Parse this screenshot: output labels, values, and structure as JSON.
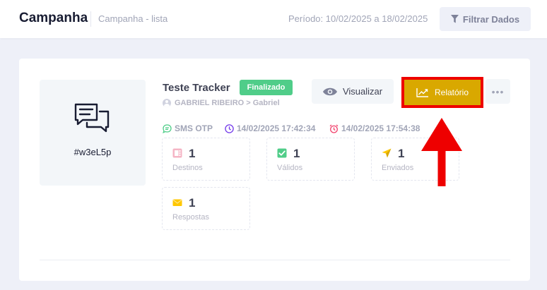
{
  "header": {
    "title": "Campanha",
    "subtitle": "Campanha - lista",
    "period": "Período: 10/02/2025 a 18/02/2025",
    "filter_label": "Filtrar Dados"
  },
  "campaign": {
    "code": "#w3eL5p",
    "name": "Teste Tracker",
    "status": "Finalizado",
    "owner": "GABRIEL RIBEIRO > Gabriel",
    "type": "SMS OTP",
    "start": "14/02/2025 17:42:34",
    "end": "14/02/2025 17:54:38"
  },
  "actions": {
    "view_label": "Visualizar",
    "report_label": "Relatório",
    "more_label": "•••"
  },
  "stats": [
    {
      "value": "1",
      "label": "Destinos",
      "icon": "contacts-icon"
    },
    {
      "value": "1",
      "label": "Válidos",
      "icon": "check-icon"
    },
    {
      "value": "1",
      "label": "Enviados",
      "icon": "send-icon"
    },
    {
      "value": "1",
      "label": "Respostas",
      "icon": "envelope-icon"
    }
  ],
  "colors": {
    "status_badge": "#50cd89",
    "report_button": "#d9a800",
    "highlight": "#ee0000",
    "sms_icon": "#50cd89",
    "start_icon": "#7239ea",
    "end_icon": "#f1416c"
  }
}
